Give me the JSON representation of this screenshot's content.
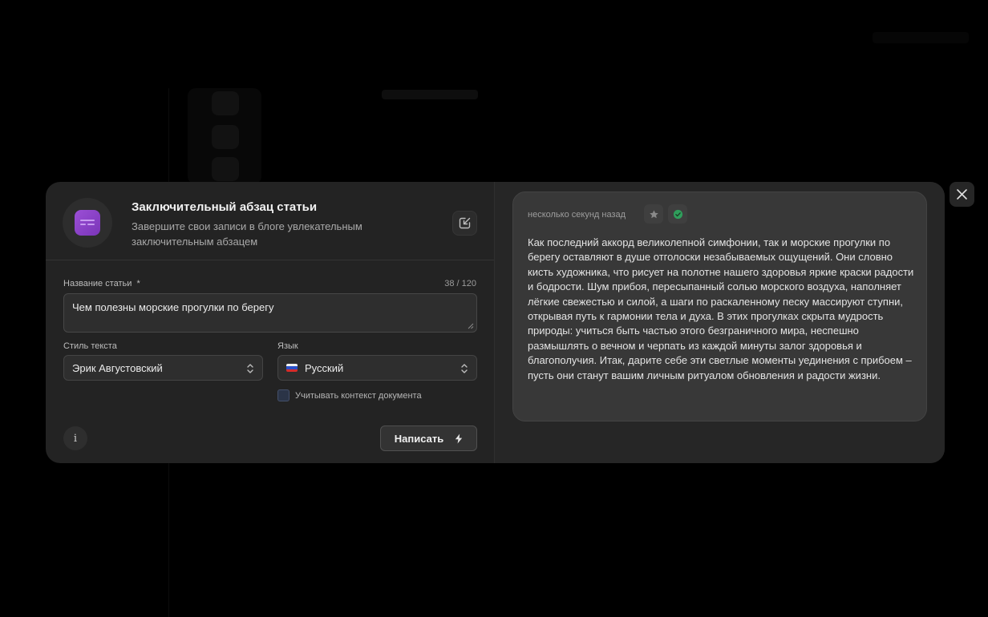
{
  "modal": {
    "title": "Заключительный абзац статьи",
    "subtitle": "Завершите свои записи в блоге увлекательным заключительным абзацем",
    "accent_color": "#8e44c9"
  },
  "form": {
    "article_title_label": "Название статьи",
    "required_mark": "*",
    "counter": "38 / 120",
    "article_title_value": "Чем полезны морские прогулки по берегу",
    "style_label": "Стиль текста",
    "style_value": "Эрик Августовский",
    "language_label": "Язык",
    "language_value": "Русский",
    "language_flag_icon": "russia-flag-icon",
    "context_checkbox_label": "Учитывать контекст документа",
    "context_checked": false,
    "write_button_label": "Написать",
    "info_button_label": "i"
  },
  "result": {
    "timestamp": "несколько секунд назад",
    "text": "Как последний аккорд великолепной симфонии, так и морские прогулки по берегу оставляют в душе отголоски незабываемых ощущений. Они словно кисть художника, что рисует на полотне нашего здоровья яркие краски радости и бодрости. Шум прибоя, пересыпанный солью морского воздуха, наполняет лёгкие свежестью и силой, а шаги по раскаленному песку массируют ступни, открывая путь к гармонии тела и духа. В этих прогулках скрыта мудрость природы: учиться быть частью этого безграничного мира, неспешно размышлять о вечном и черпать из каждой минуты залог здоровья и благополучия. Итак, дарите себе эти светлые моменты уединения с прибоем – пусть они станут вашим личным ритуалом обновления и радости жизни."
  }
}
